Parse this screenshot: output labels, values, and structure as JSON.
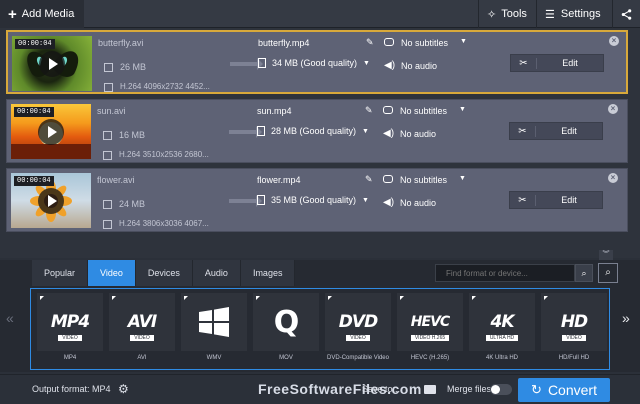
{
  "toolbar": {
    "add_media_label": "Add Media",
    "tools_label": "Tools",
    "settings_label": "Settings"
  },
  "files": [
    {
      "duration": "00:00:04",
      "source_name": "butterfly.avi",
      "source_size": "26 MB",
      "source_codec": "H.264 4096x2732 4452...",
      "output_name": "butterfly.mp4",
      "output_size": "34 MB (Good quality)",
      "subtitles": "No subtitles",
      "audio": "No audio",
      "edit_label": "Edit",
      "selected": true
    },
    {
      "duration": "00:00:04",
      "source_name": "sun.avi",
      "source_size": "16 MB",
      "source_codec": "H.264 3510x2536 2680...",
      "output_name": "sun.mp4",
      "output_size": "28 MB (Good quality)",
      "subtitles": "No subtitles",
      "audio": "No audio",
      "edit_label": "Edit",
      "selected": false
    },
    {
      "duration": "00:00:04",
      "source_name": "flower.avi",
      "source_size": "24 MB",
      "source_codec": "H.264 3806x3036 4067...",
      "output_name": "flower.mp4",
      "output_size": "35 MB (Good quality)",
      "subtitles": "No subtitles",
      "audio": "No audio",
      "edit_label": "Edit",
      "selected": false
    }
  ],
  "format_panel": {
    "tabs": [
      "Popular",
      "Video",
      "Devices",
      "Audio",
      "Images"
    ],
    "active_tab": "Video",
    "search_placeholder": "Find format or device...",
    "formats": [
      {
        "logo": "MP4",
        "sub": "VIDEO",
        "caption": "MP4"
      },
      {
        "logo": "AVI",
        "sub": "VIDEO",
        "caption": "AVI"
      },
      {
        "logo": "",
        "sub": "",
        "caption": "WMV"
      },
      {
        "logo": "Q",
        "sub": "",
        "caption": "MOV"
      },
      {
        "logo": "DVD",
        "sub": "VIDEO",
        "caption": "DVD-Compatible Video"
      },
      {
        "logo": "HEVC",
        "sub": "VIDEO H.265",
        "caption": "HEVC (H.265)"
      },
      {
        "logo": "4K",
        "sub": "ULTRA HD",
        "caption": "4K Ultra HD"
      },
      {
        "logo": "HD",
        "sub": "VIDEO",
        "caption": "HD/Full HD"
      }
    ]
  },
  "bottom": {
    "output_format": "Output format: MP4",
    "watermark": "FreeSoftwareFiles.com",
    "save_to": "Save to...",
    "merge_files": "Merge files",
    "convert": "Convert"
  },
  "colors": {
    "accent": "#2f8be3",
    "selection_border": "#d8a93b",
    "row_bg": "#5e6275"
  }
}
